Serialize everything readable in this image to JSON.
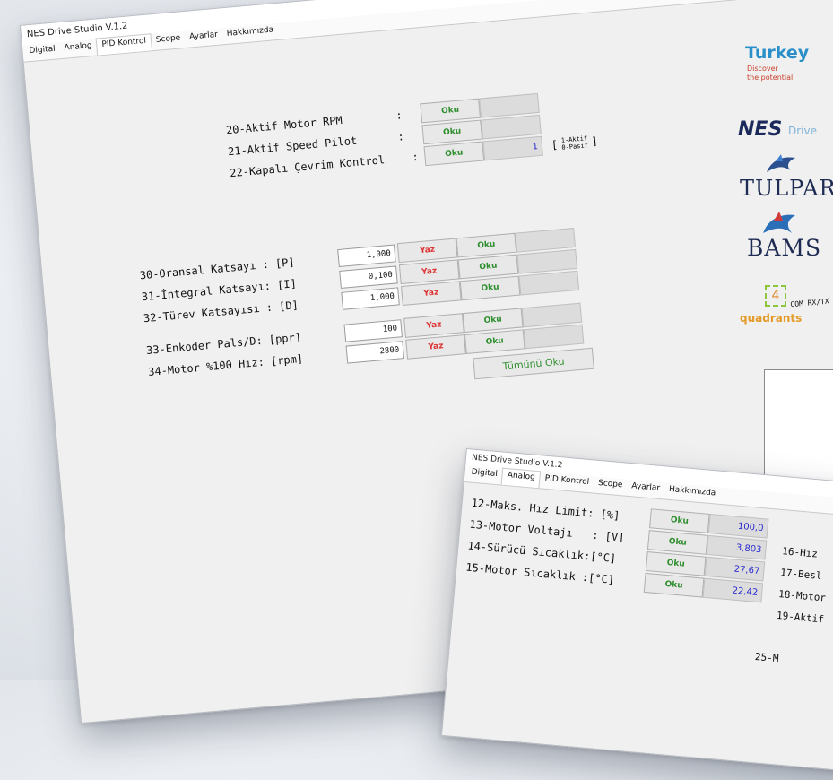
{
  "window1": {
    "title": "NES Drive Studio V.1.2",
    "tabs": [
      "Digital",
      "Analog",
      "PID Kontrol",
      "Scope",
      "Ayarlar",
      "Hakkımızda"
    ],
    "active_tab": "PID Kontrol",
    "status_rows": [
      {
        "label": "20-Aktif Motor RPM",
        "sep": ":",
        "button": "Oku",
        "value": ""
      },
      {
        "label": "21-Aktif Speed Pilot",
        "sep": ":",
        "button": "Oku",
        "value": ""
      },
      {
        "label": "22-Kapalı Çevrim Kontrol",
        "sep": ":",
        "button": "Oku",
        "value": "1"
      }
    ],
    "legend": {
      "line1": "1-Aktif",
      "line2": "0-Pasif"
    },
    "param_rows": [
      {
        "label": "30-Oransal Katsayı : [P]",
        "input": "1,000",
        "write": "Yaz",
        "read": "Oku"
      },
      {
        "label": "31-İntegral Katsayı: [I]",
        "input": "0,100",
        "write": "Yaz",
        "read": "Oku"
      },
      {
        "label": "32-Türev Katsayısı : [D]",
        "input": "1,000",
        "write": "Yaz",
        "read": "Oku"
      },
      {
        "label": "33-Enkoder Pals/D: [ppr]",
        "input": "100",
        "write": "Yaz",
        "read": "Oku"
      },
      {
        "label": "34-Motor %100 Hız: [rpm]",
        "input": "2800",
        "write": "Yaz",
        "read": "Oku"
      }
    ],
    "read_all": "Tümünü Oku",
    "com_label": "COM RX/TX"
  },
  "window2": {
    "title": "NES Drive Studio V.1.2",
    "tabs": [
      "Digital",
      "Analog",
      "PID Kontrol",
      "Scope",
      "Ayarlar",
      "Hakkımızda"
    ],
    "active_tab": "Analog",
    "rows": [
      {
        "label": "12-Maks. Hız Limit: [%]",
        "button": "Oku",
        "value": "100,0"
      },
      {
        "label": "13-Motor Voltajı   : [V]",
        "button": "Oku",
        "value": "3,803"
      },
      {
        "label": "14-Sürücü Sıcaklık:[°C]",
        "button": "Oku",
        "value": "27,67"
      },
      {
        "label": "15-Motor Sıcaklık :[°C]",
        "button": "Oku",
        "value": "22,42"
      }
    ],
    "right_labels": [
      "16-Hız",
      "17-Besl",
      "18-Motor",
      "19-Aktif"
    ],
    "bottom_label": "25-M"
  },
  "sidebar": {
    "turkey_title": "Turkey",
    "turkey_sub1": "Discover",
    "turkey_sub2": "the potential",
    "nes_logo": "NES",
    "nes_suffix": "Drive",
    "tulpar": "TULPAR",
    "bams": "BAMS",
    "quadrant_digit": "4",
    "quadrants": "quadrants"
  },
  "colors": {
    "read": "#2f8f2f",
    "write": "#d33333",
    "value": "#2a2ad0"
  }
}
